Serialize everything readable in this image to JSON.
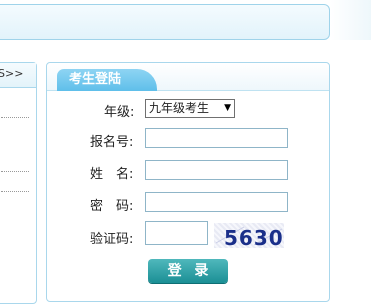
{
  "left_panel": {
    "more_label": "S>>"
  },
  "login": {
    "title": "考生登陆",
    "grade_label": "年级:",
    "grade_selected": "九年级考生",
    "reg_no_label": "报名号:",
    "name_label": "姓　名:",
    "password_label": "密　码:",
    "captcha_label": "验证码:",
    "captcha_text": "5630",
    "login_button": "登 录"
  }
}
